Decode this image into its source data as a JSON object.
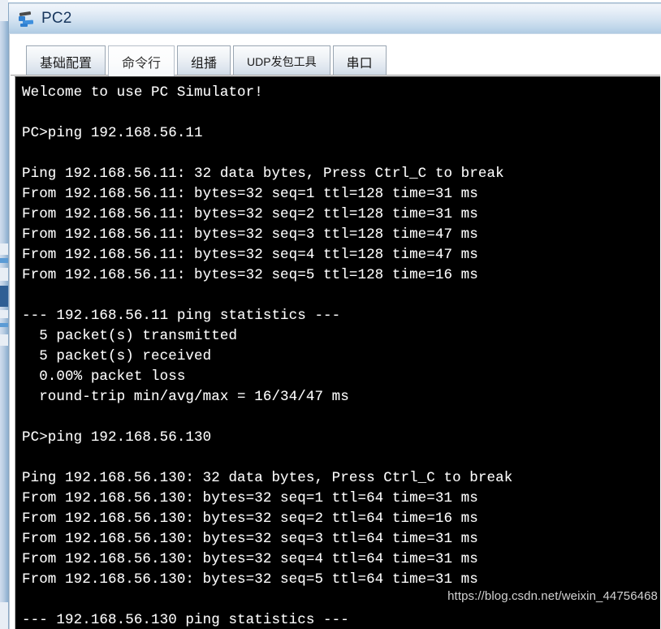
{
  "window": {
    "title": "PC2",
    "icon": "pc-device-icon"
  },
  "tabs": [
    {
      "label": "基础配置",
      "selected": false,
      "small": false
    },
    {
      "label": "命令行",
      "selected": true,
      "small": false
    },
    {
      "label": "组播",
      "selected": false,
      "small": false
    },
    {
      "label": "UDP发包工具",
      "selected": false,
      "small": true
    },
    {
      "label": "串口",
      "selected": false,
      "small": false
    }
  ],
  "terminal": {
    "lines": [
      "Welcome to use PC Simulator!",
      "",
      "PC>ping 192.168.56.11",
      "",
      "Ping 192.168.56.11: 32 data bytes, Press Ctrl_C to break",
      "From 192.168.56.11: bytes=32 seq=1 ttl=128 time=31 ms",
      "From 192.168.56.11: bytes=32 seq=2 ttl=128 time=31 ms",
      "From 192.168.56.11: bytes=32 seq=3 ttl=128 time=47 ms",
      "From 192.168.56.11: bytes=32 seq=4 ttl=128 time=47 ms",
      "From 192.168.56.11: bytes=32 seq=5 ttl=128 time=16 ms",
      "",
      "--- 192.168.56.11 ping statistics ---",
      "  5 packet(s) transmitted",
      "  5 packet(s) received",
      "  0.00% packet loss",
      "  round-trip min/avg/max = 16/34/47 ms",
      "",
      "PC>ping 192.168.56.130",
      "",
      "Ping 192.168.56.130: 32 data bytes, Press Ctrl_C to break",
      "From 192.168.56.130: bytes=32 seq=1 ttl=64 time=31 ms",
      "From 192.168.56.130: bytes=32 seq=2 ttl=64 time=16 ms",
      "From 192.168.56.130: bytes=32 seq=3 ttl=64 time=31 ms",
      "From 192.168.56.130: bytes=32 seq=4 ttl=64 time=31 ms",
      "From 192.168.56.130: bytes=32 seq=5 ttl=64 time=31 ms",
      "",
      "--- 192.168.56.130 ping statistics ---"
    ],
    "ping_sessions": [
      {
        "command": "ping 192.168.56.11",
        "target": "192.168.56.11",
        "data_bytes": 32,
        "replies": [
          {
            "seq": 1,
            "bytes": 32,
            "ttl": 128,
            "time_ms": 31
          },
          {
            "seq": 2,
            "bytes": 32,
            "ttl": 128,
            "time_ms": 31
          },
          {
            "seq": 3,
            "bytes": 32,
            "ttl": 128,
            "time_ms": 47
          },
          {
            "seq": 4,
            "bytes": 32,
            "ttl": 128,
            "time_ms": 47
          },
          {
            "seq": 5,
            "bytes": 32,
            "ttl": 128,
            "time_ms": 16
          }
        ],
        "transmitted": 5,
        "received": 5,
        "packet_loss": "0.00%",
        "rtt_min_ms": 16,
        "rtt_avg_ms": 34,
        "rtt_max_ms": 47
      },
      {
        "command": "ping 192.168.56.130",
        "target": "192.168.56.130",
        "data_bytes": 32,
        "replies": [
          {
            "seq": 1,
            "bytes": 32,
            "ttl": 64,
            "time_ms": 31
          },
          {
            "seq": 2,
            "bytes": 32,
            "ttl": 64,
            "time_ms": 16
          },
          {
            "seq": 3,
            "bytes": 32,
            "ttl": 64,
            "time_ms": 31
          },
          {
            "seq": 4,
            "bytes": 32,
            "ttl": 64,
            "time_ms": 31
          },
          {
            "seq": 5,
            "bytes": 32,
            "ttl": 64,
            "time_ms": 31
          }
        ]
      }
    ]
  },
  "watermark": {
    "text": "https://blog.csdn.net/weixin_44756468"
  },
  "colors": {
    "terminal_bg": "#000000",
    "terminal_fg": "#ffffff",
    "title_text": "#17365d",
    "accent_blue": "#3e8fdd",
    "watermark": "#d2d2d2"
  }
}
